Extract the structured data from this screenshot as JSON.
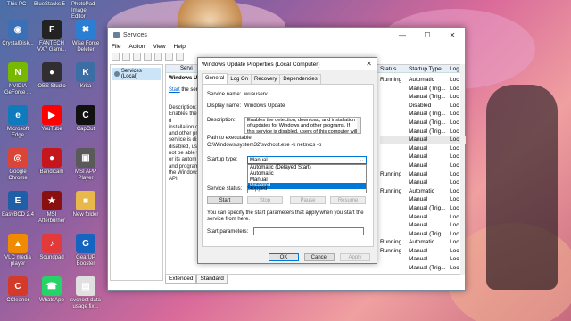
{
  "desktop": {
    "top_labels": [
      "This PC",
      "BlueStacks 5",
      "PhotoPad Image Editor"
    ],
    "icons": [
      {
        "label": "CrystalDisk...",
        "glyph": "◉",
        "color": "#3b6fb6"
      },
      {
        "label": "FANTECH VX7 Gami...",
        "glyph": "F",
        "color": "#222222"
      },
      {
        "label": "Wise Force Deleter",
        "glyph": "✖",
        "color": "#2a7fd4"
      },
      {
        "label": "NVIDIA GeForce ...",
        "glyph": "N",
        "color": "#76b900"
      },
      {
        "label": "OBS Studio",
        "glyph": "●",
        "color": "#302e31"
      },
      {
        "label": "Krita",
        "glyph": "K",
        "color": "#3a6ea5"
      },
      {
        "label": "Microsoft Edge",
        "glyph": "e",
        "color": "#0f7bbd"
      },
      {
        "label": "YouTube",
        "glyph": "▶",
        "color": "#ff0000"
      },
      {
        "label": "CapCut",
        "glyph": "C",
        "color": "#111111"
      },
      {
        "label": "Google Chrome",
        "glyph": "◎",
        "color": "#db4437"
      },
      {
        "label": "Bandicam",
        "glyph": "●",
        "color": "#c4161c"
      },
      {
        "label": "MSI APP Player",
        "glyph": "▣",
        "color": "#5a5a5a"
      },
      {
        "label": "EasyBCD 2.4",
        "glyph": "E",
        "color": "#1f5fa8"
      },
      {
        "label": "MSI Afterburner",
        "glyph": "★",
        "color": "#8a1010"
      },
      {
        "label": "New folder",
        "glyph": "■",
        "color": "#e8b84a"
      },
      {
        "label": "VLC media player",
        "glyph": "▲",
        "color": "#f08a00"
      },
      {
        "label": "Soundpad",
        "glyph": "♪",
        "color": "#e23a3a"
      },
      {
        "label": "GearUP Booster",
        "glyph": "G",
        "color": "#1565c0"
      },
      {
        "label": "CCleaner",
        "glyph": "C",
        "color": "#d43a2a"
      },
      {
        "label": "WhatsApp",
        "glyph": "☎",
        "color": "#25d366"
      },
      {
        "label": "svchost data usage fix...",
        "glyph": "▤",
        "color": "#e0e0e0"
      }
    ]
  },
  "services_window": {
    "title": "Services",
    "menu": [
      "File",
      "Action",
      "View",
      "Help"
    ],
    "tree_node": "Services (Local)",
    "header_strip": "Servi",
    "desc_title": "Windows Up",
    "desc_link_prefix": "Start",
    "desc_link_suffix": " the servi",
    "desc_body": "Description:\nEnables the d\ninstallation o\nand other pr\nservice is dis\ndisabled, use\nnot be able t\nor its autom\nand program\nthe Windows\nAPI.",
    "columns": {
      "status": "Status",
      "startup": "Startup Type",
      "log": "Log"
    },
    "rows": [
      {
        "status": "Running",
        "startup": "Automatic",
        "log": "Loc"
      },
      {
        "status": "",
        "startup": "Manual (Trig...",
        "log": "Loc"
      },
      {
        "status": "",
        "startup": "Manual (Trig...",
        "log": "Loc"
      },
      {
        "status": "",
        "startup": "Disabled",
        "log": "Loc"
      },
      {
        "status": "",
        "startup": "Manual (Trig...",
        "log": "Loc"
      },
      {
        "status": "",
        "startup": "Manual (Trig...",
        "log": "Loc"
      },
      {
        "status": "",
        "startup": "Manual (Trig...",
        "log": "Loc"
      },
      {
        "status": "",
        "startup": "Manual",
        "log": "Loc"
      },
      {
        "status": "",
        "startup": "Manual",
        "log": "Loc"
      },
      {
        "status": "",
        "startup": "Manual",
        "log": "Loc"
      },
      {
        "status": "",
        "startup": "Manual",
        "log": "Loc"
      },
      {
        "status": "Running",
        "startup": "Manual",
        "log": "Loc"
      },
      {
        "status": "",
        "startup": "Manual",
        "log": "Loc"
      },
      {
        "status": "Running",
        "startup": "Automatic",
        "log": "Loc"
      },
      {
        "status": "",
        "startup": "Manual",
        "log": "Loc"
      },
      {
        "status": "",
        "startup": "Manual (Trig...",
        "log": "Loc"
      },
      {
        "status": "",
        "startup": "Manual",
        "log": "Loc"
      },
      {
        "status": "",
        "startup": "Manual",
        "log": "Loc"
      },
      {
        "status": "",
        "startup": "Manual (Trig...",
        "log": "Loc"
      },
      {
        "status": "Running",
        "startup": "Automatic",
        "log": "Loc"
      },
      {
        "status": "Running",
        "startup": "Manual",
        "log": "Loc"
      },
      {
        "status": "",
        "startup": "Manual",
        "log": "Loc"
      },
      {
        "status": "",
        "startup": "Manual (Trig...",
        "log": "Loc"
      }
    ],
    "selected_row_index": 7,
    "bottom_tabs": [
      "Extended",
      "Standard"
    ]
  },
  "properties_dialog": {
    "title": "Windows Update Properties (Local Computer)",
    "tabs": [
      "General",
      "Log On",
      "Recovery",
      "Dependencies"
    ],
    "service_name_label": "Service name:",
    "service_name": "wuauserv",
    "display_name_label": "Display name:",
    "display_name": "Windows Update",
    "description_label": "Description:",
    "description": "Enables the detection, download, and installation of updates for Windows and other programs. If this service is disabled, users of this computer will not be",
    "path_label": "Path to executable:",
    "path": "C:\\Windows\\system32\\svchost.exe -k netsvcs -p",
    "startup_type_label": "Startup type:",
    "startup_type_value": "Manual",
    "startup_options": [
      "Automatic (Delayed Start)",
      "Automatic",
      "Manual",
      "Disabled"
    ],
    "highlighted_option_index": 3,
    "service_status_label": "Service status:",
    "service_status": "Stopped",
    "start_btn": "Start",
    "stop_btn": "Stop",
    "pause_btn": "Pause",
    "resume_btn": "Resume",
    "hint": "You can specify the start parameters that apply when you start the service from here.",
    "start_params_label": "Start parameters:",
    "ok_btn": "OK",
    "cancel_btn": "Cancel",
    "apply_btn": "Apply"
  }
}
